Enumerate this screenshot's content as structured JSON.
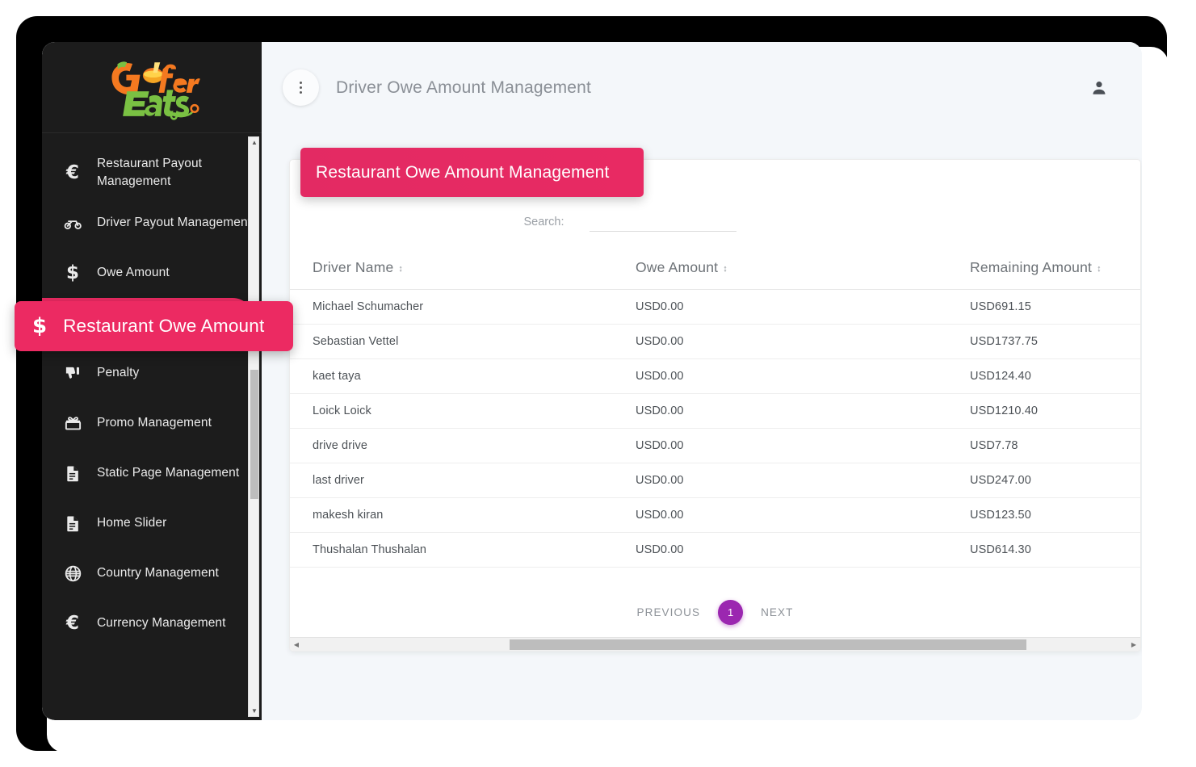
{
  "brand": {
    "name": "Gofer Eats",
    "word_one": "Gofer",
    "word_two": "Eats",
    "color_orange": "#F47920",
    "color_green": "#7AC143"
  },
  "header": {
    "title": "Driver Owe Amount Management",
    "menu_icon": "kebab-menu-icon",
    "user_icon": "user-account-icon"
  },
  "sidebar": {
    "items": [
      {
        "label": "Restaurant Payout Management",
        "icon": "euro-icon",
        "glyph": "€",
        "active": false
      },
      {
        "label": "Driver Payout Management",
        "icon": "motorbike-icon",
        "glyph": "",
        "active": false
      },
      {
        "label": "Owe Amount",
        "icon": "dollar-icon",
        "glyph": "$",
        "active": false
      },
      {
        "label": "Restaurant Owe Amount",
        "icon": "dollar-icon",
        "glyph": "$",
        "active": true
      },
      {
        "label": "Penalty",
        "icon": "thumbs-down-icon",
        "glyph": "",
        "active": false
      },
      {
        "label": "Promo Management",
        "icon": "gift-icon",
        "glyph": "",
        "active": false
      },
      {
        "label": "Static Page Management",
        "icon": "document-icon",
        "glyph": "",
        "active": false
      },
      {
        "label": "Home Slider",
        "icon": "document-icon",
        "glyph": "",
        "active": false
      },
      {
        "label": "Country Management",
        "icon": "globe-icon",
        "glyph": "",
        "active": false
      },
      {
        "label": "Currency Management",
        "icon": "euro-icon",
        "glyph": "€",
        "active": false
      }
    ]
  },
  "tooltips": {
    "sidebar_tooltip": "Restaurant Owe Amount",
    "sidebar_tooltip_icon": "dollar-icon",
    "card_tooltip": "Restaurant Owe Amount Management",
    "accent_color": "#EC2A62"
  },
  "search": {
    "label": "Search:",
    "value": "",
    "placeholder": ""
  },
  "table": {
    "columns": [
      {
        "label": "Driver Name",
        "sort": "↕"
      },
      {
        "label": "Owe Amount",
        "sort": "↕"
      },
      {
        "label": "Remaining Amount",
        "sort": "↕"
      }
    ],
    "rows": [
      {
        "driver_name": "Michael Schumacher",
        "owe_amount": "USD0.00",
        "remaining_amount": "USD691.15"
      },
      {
        "driver_name": "Sebastian Vettel",
        "owe_amount": "USD0.00",
        "remaining_amount": "USD1737.75"
      },
      {
        "driver_name": "kaet taya",
        "owe_amount": "USD0.00",
        "remaining_amount": "USD124.40"
      },
      {
        "driver_name": "Loick Loick",
        "owe_amount": "USD0.00",
        "remaining_amount": "USD1210.40"
      },
      {
        "driver_name": "drive drive",
        "owe_amount": "USD0.00",
        "remaining_amount": "USD7.78"
      },
      {
        "driver_name": "last driver",
        "owe_amount": "USD0.00",
        "remaining_amount": "USD247.00"
      },
      {
        "driver_name": "makesh kiran",
        "owe_amount": "USD0.00",
        "remaining_amount": "USD123.50"
      },
      {
        "driver_name": "Thushalan Thushalan",
        "owe_amount": "USD0.00",
        "remaining_amount": "USD614.30"
      }
    ]
  },
  "pagination": {
    "previous": "PREVIOUS",
    "current_page": "1",
    "next": "NEXT",
    "active_color": "#9B27B0"
  }
}
